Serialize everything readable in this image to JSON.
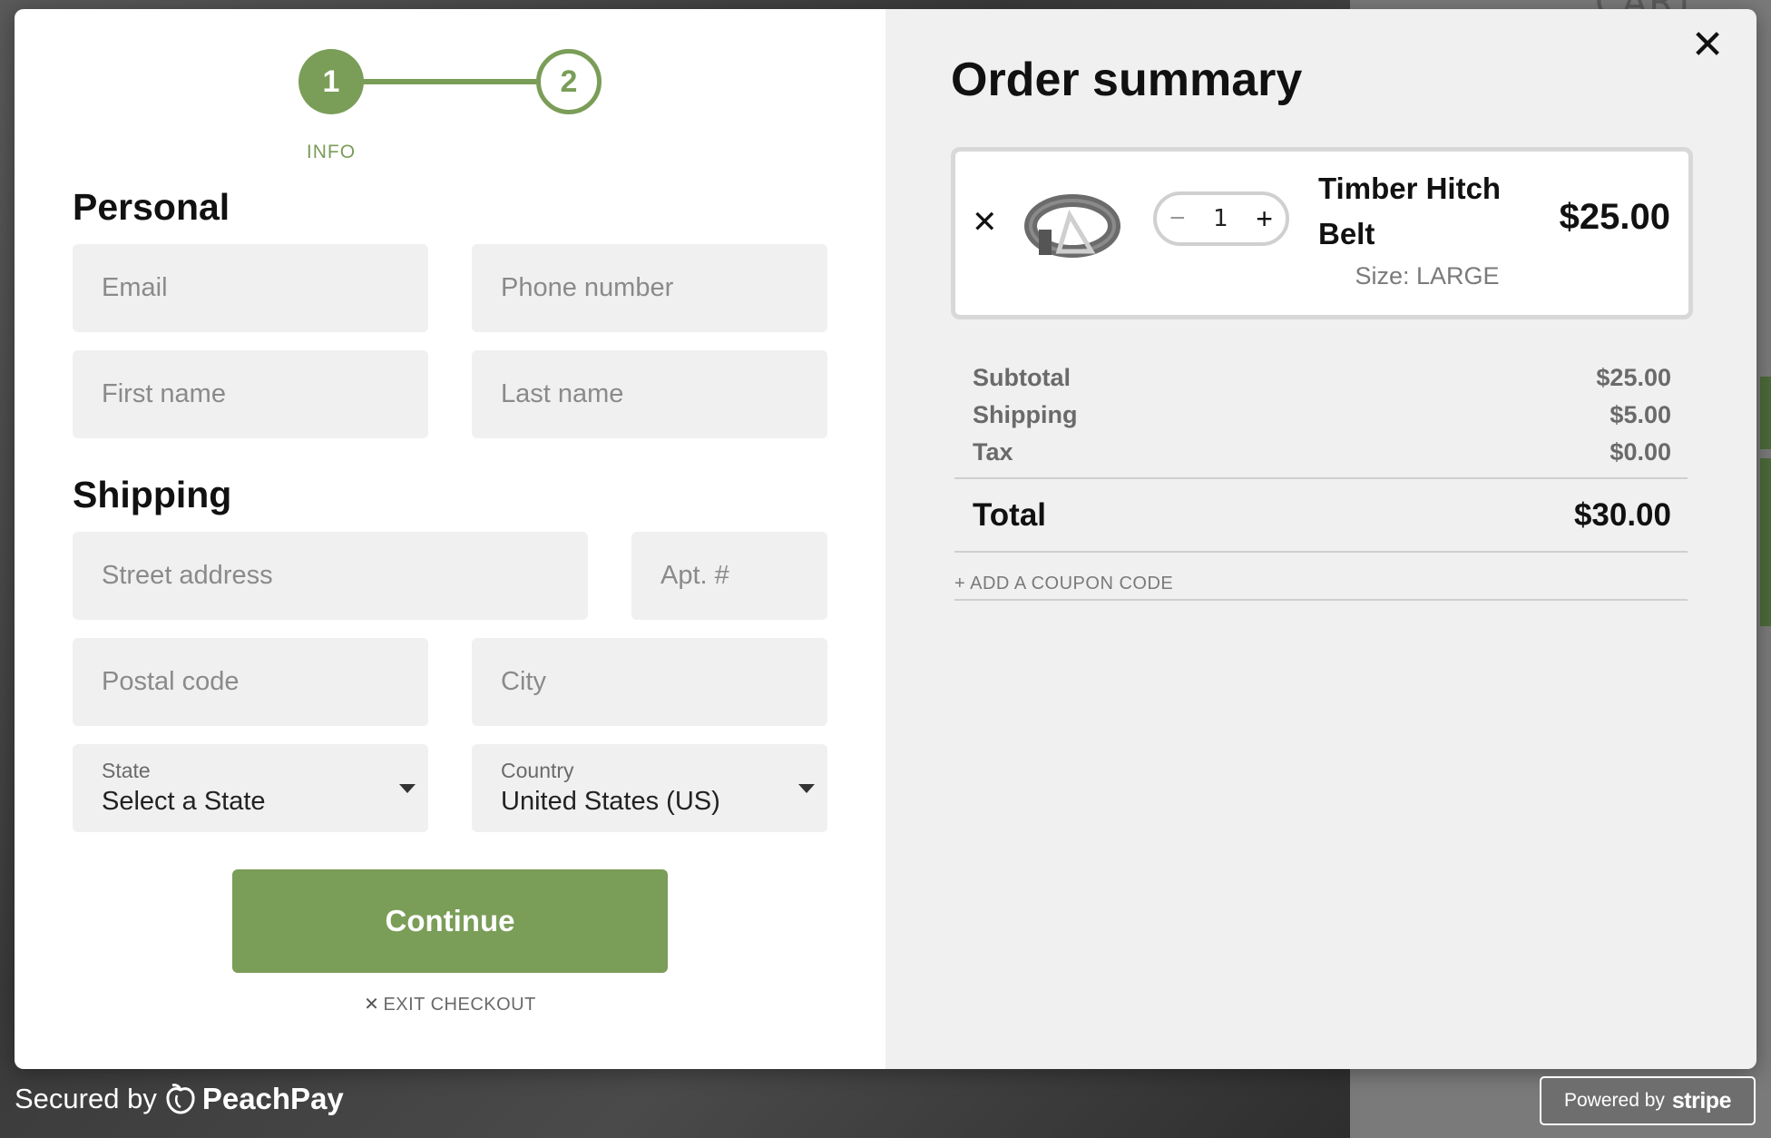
{
  "stepper": {
    "steps": [
      {
        "number": "1",
        "label": "INFO"
      },
      {
        "number": "2",
        "label": ""
      }
    ]
  },
  "personal": {
    "title": "Personal",
    "email_placeholder": "Email",
    "phone_placeholder": "Phone number",
    "first_name_placeholder": "First name",
    "last_name_placeholder": "Last name"
  },
  "shipping": {
    "title": "Shipping",
    "street_placeholder": "Street address",
    "apt_placeholder": "Apt. #",
    "postal_placeholder": "Postal code",
    "city_placeholder": "City",
    "state": {
      "label": "State",
      "value": "Select a State"
    },
    "country": {
      "label": "Country",
      "value": "United States (US)"
    }
  },
  "actions": {
    "continue_label": "Continue",
    "exit_label": "EXIT CHECKOUT",
    "close_symbol": "✕"
  },
  "order_summary": {
    "title": "Order summary",
    "item": {
      "name": "Timber Hitch Belt",
      "size": "Size: LARGE",
      "quantity": "1",
      "price": "$25.00"
    },
    "subtotal_label": "Subtotal",
    "subtotal_value": "$25.00",
    "shipping_label": "Shipping",
    "shipping_value": "$5.00",
    "tax_label": "Tax",
    "tax_value": "$0.00",
    "total_label": "Total",
    "total_value": "$30.00",
    "coupon_label": "+ ADD A COUPON CODE"
  },
  "footer": {
    "secured_prefix": "Secured by",
    "brand_name": "PeachPay",
    "powered_prefix": "Powered by",
    "powered_brand": "stripe"
  },
  "background": {
    "cart_text": "CART"
  },
  "colors": {
    "accent": "#7a9d58",
    "panel_bg": "#f0f0f0"
  }
}
